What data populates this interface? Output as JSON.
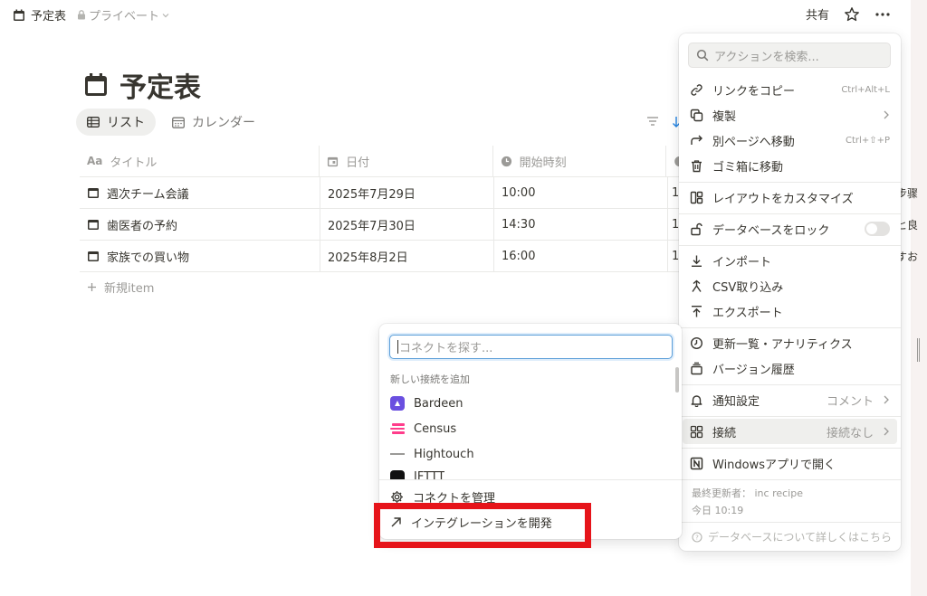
{
  "breadcrumb": {
    "page": "予定表",
    "privacy": "プライベート"
  },
  "topbar": {
    "share": "共有"
  },
  "page": {
    "title": "予定表"
  },
  "views": [
    {
      "label": "リスト",
      "active": true
    },
    {
      "label": "カレンダー",
      "active": false
    }
  ],
  "table": {
    "columns": [
      {
        "label": "タイトル",
        "prefix": "Aa"
      },
      {
        "label": "日付"
      },
      {
        "label": "開始時刻"
      }
    ],
    "rows": [
      {
        "title": "週次チーム会議",
        "date": "2025年7月29日",
        "time": "10:00",
        "col4": "1",
        "right": "步骤"
      },
      {
        "title": "歯医者の予約",
        "date": "2025年7月30日",
        "time": "14:30",
        "col4": "1",
        "right": "ヒ良"
      },
      {
        "title": "家族での買い物",
        "date": "2025年8月2日",
        "time": "16:00",
        "col4": "1",
        "right": "すお"
      }
    ],
    "new_item": "新規item"
  },
  "menu": {
    "search_placeholder": "アクションを検索...",
    "items": {
      "copy_link": {
        "label": "リンクをコピー",
        "shortcut": "Ctrl+Alt+L"
      },
      "duplicate": {
        "label": "複製"
      },
      "move": {
        "label": "別ページへ移動",
        "shortcut": "Ctrl+⇧+P"
      },
      "trash": {
        "label": "ゴミ箱に移動"
      },
      "layout": {
        "label": "レイアウトをカスタマイズ"
      },
      "lock": {
        "label": "データベースをロック"
      },
      "import": {
        "label": "インポート"
      },
      "csv": {
        "label": "CSV取り込み"
      },
      "export": {
        "label": "エクスポート"
      },
      "updates": {
        "label": "更新一覧・アナリティクス"
      },
      "versions": {
        "label": "バージョン履歴"
      },
      "notify": {
        "label": "通知設定",
        "value": "コメント"
      },
      "connections": {
        "label": "接続",
        "value": "接続なし"
      },
      "windows": {
        "label": "Windowsアプリで開く"
      }
    },
    "meta": {
      "last_updated_label": "最終更新者： inc recipe",
      "last_updated_time": "今日 10:19"
    },
    "learn_more": "データベースについて詳しくはこちら"
  },
  "connections_popup": {
    "search_placeholder": "コネクトを探す...",
    "section": "新しい接続を追加",
    "apps": [
      {
        "name": "Bardeen",
        "color": "#6a4fe0"
      },
      {
        "name": "Census",
        "color": "#ff3d8b"
      },
      {
        "name": "Hightouch",
        "color": "#3c3c3c"
      },
      {
        "name": "IFTTT",
        "color": "#111111"
      }
    ],
    "manage": "コネクトを管理",
    "develop": "インテグレーションを開発"
  },
  "colors": {
    "highlight_box": "#e6141a",
    "focus_ring": "#5b9ed8"
  }
}
